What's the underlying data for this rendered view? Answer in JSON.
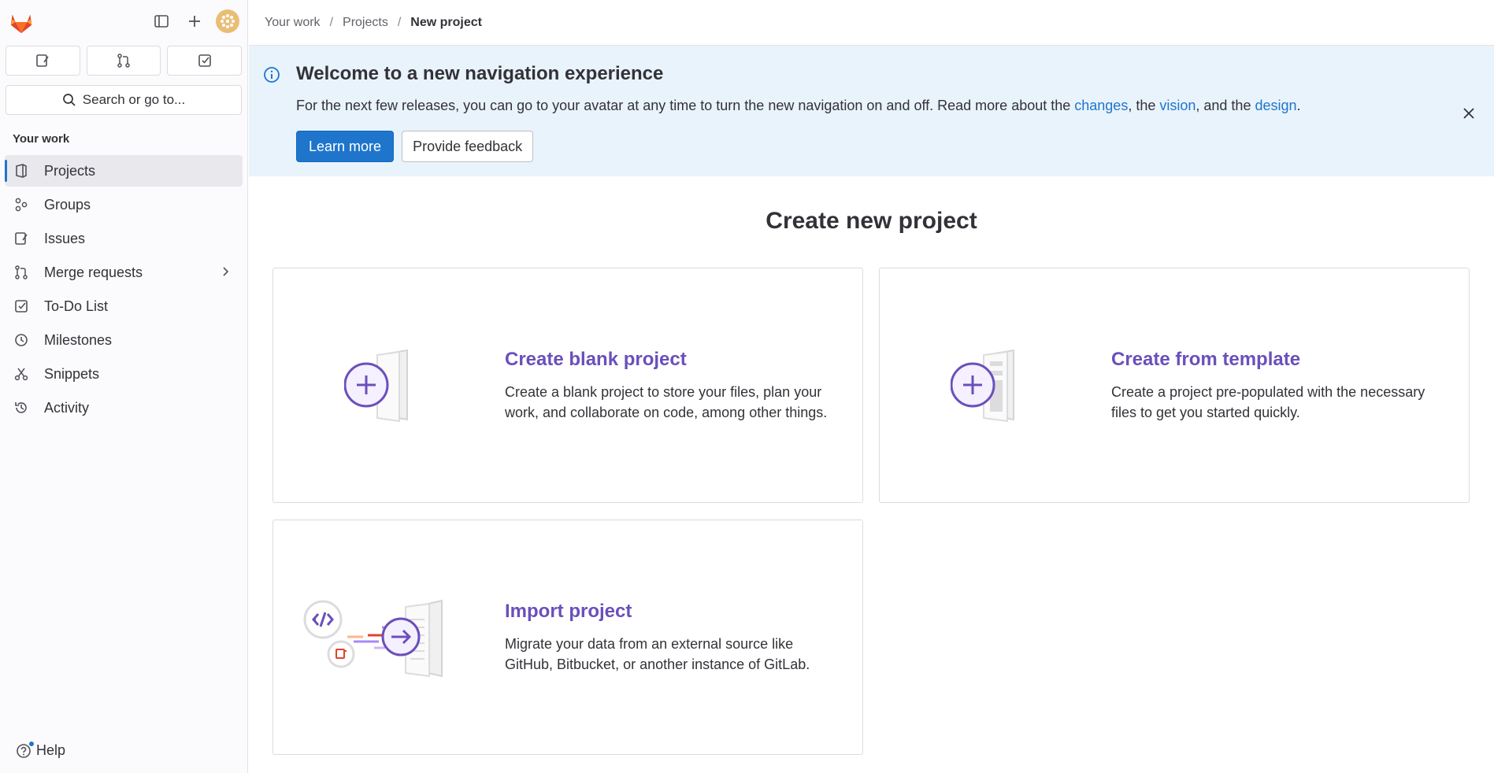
{
  "sidebar": {
    "counters": [
      {
        "name": "issues-counter-button",
        "icon": "issues-icon"
      },
      {
        "name": "merge-requests-counter-button",
        "icon": "merge-request-icon"
      },
      {
        "name": "todos-counter-button",
        "icon": "todo-icon"
      }
    ],
    "search_label": "Search or go to...",
    "section_title": "Your work",
    "items": [
      {
        "label": "Projects",
        "icon": "project-icon",
        "active": true
      },
      {
        "label": "Groups",
        "icon": "group-icon"
      },
      {
        "label": "Issues",
        "icon": "issues-icon"
      },
      {
        "label": "Merge requests",
        "icon": "merge-request-icon",
        "has_chevron": true
      },
      {
        "label": "To-Do List",
        "icon": "todo-icon"
      },
      {
        "label": "Milestones",
        "icon": "milestone-icon"
      },
      {
        "label": "Snippets",
        "icon": "snippet-icon"
      },
      {
        "label": "Activity",
        "icon": "activity-icon"
      }
    ],
    "help_label": "Help"
  },
  "breadcrumb": {
    "items": [
      "Your work",
      "Projects",
      "New project"
    ],
    "separator": "/"
  },
  "banner": {
    "title": "Welcome to a new navigation experience",
    "text_before": "For the next few releases, you can go to your avatar at any time to turn the new navigation on and off. Read more about the ",
    "link_changes": "changes",
    "text_mid1": ", the ",
    "link_vision": "vision",
    "text_mid2": ", and the ",
    "link_design": "design",
    "text_end": ".",
    "learn_more": "Learn more",
    "feedback": "Provide feedback"
  },
  "main": {
    "title": "Create new project",
    "cards": [
      {
        "title": "Create blank project",
        "description": "Create a blank project to store your files, plan your work, and collaborate on code, among other things."
      },
      {
        "title": "Create from template",
        "description": "Create a project pre-populated with the necessary files to get you started quickly."
      },
      {
        "title": "Import project",
        "description": "Migrate your data from an external source like GitHub, Bitbucket, or another instance of GitLab."
      }
    ]
  },
  "colors": {
    "brand_purple": "#6b4fbb",
    "link_blue": "#1f75cb",
    "banner_bg": "#e9f3fc"
  }
}
